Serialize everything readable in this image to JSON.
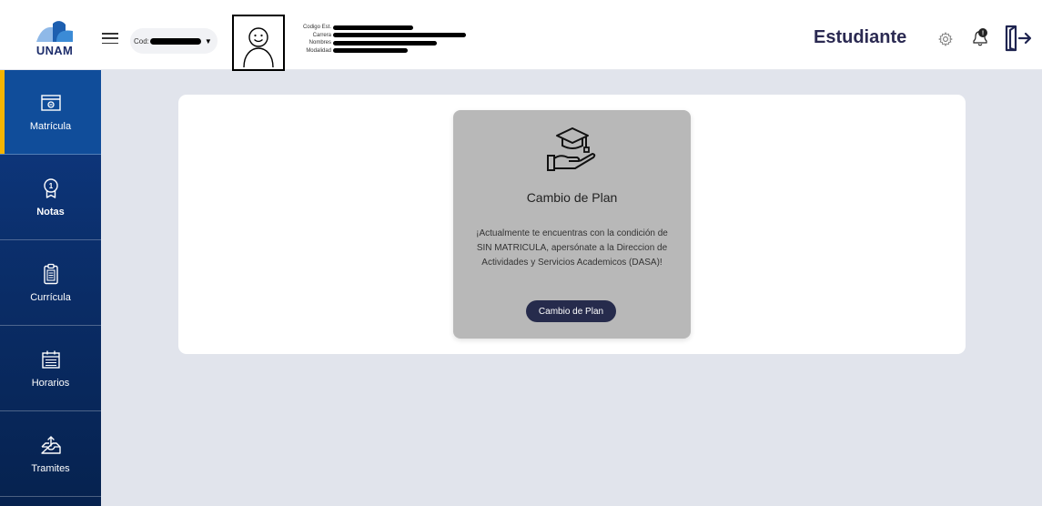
{
  "header": {
    "logo_text": "UNAM",
    "cod_label": "Cod:",
    "info_labels": [
      "Codigo Est.",
      "Carrera",
      "Nombres",
      "Modalidad"
    ],
    "role": "Estudiante"
  },
  "sidebar": {
    "items": [
      {
        "label": "Matrícula",
        "icon": "card-icon",
        "active": true
      },
      {
        "label": "Notas",
        "icon": "award-icon",
        "active": false
      },
      {
        "label": "Currícula",
        "icon": "clipboard-icon",
        "active": false
      },
      {
        "label": "Horarios",
        "icon": "calendar-icon",
        "active": false
      },
      {
        "label": "Tramites",
        "icon": "inbox-upload-icon",
        "active": false
      }
    ]
  },
  "main": {
    "card": {
      "icon": "graduation-cap-hand-icon",
      "title": "Cambio de Plan",
      "description": "¡Actualmente te encuentras con la condición de SIN MATRICULA, apersónate a la Direccion de Actividades y Servicios Academicos (DASA)!",
      "button_label": "Cambio de Plan"
    }
  },
  "colors": {
    "sidebar": "#0b2f6c",
    "active_indicator": "#f5b400",
    "role_text": "#2b2a52",
    "card_bg": "#b8b8b8",
    "button_bg": "#262b4c"
  }
}
